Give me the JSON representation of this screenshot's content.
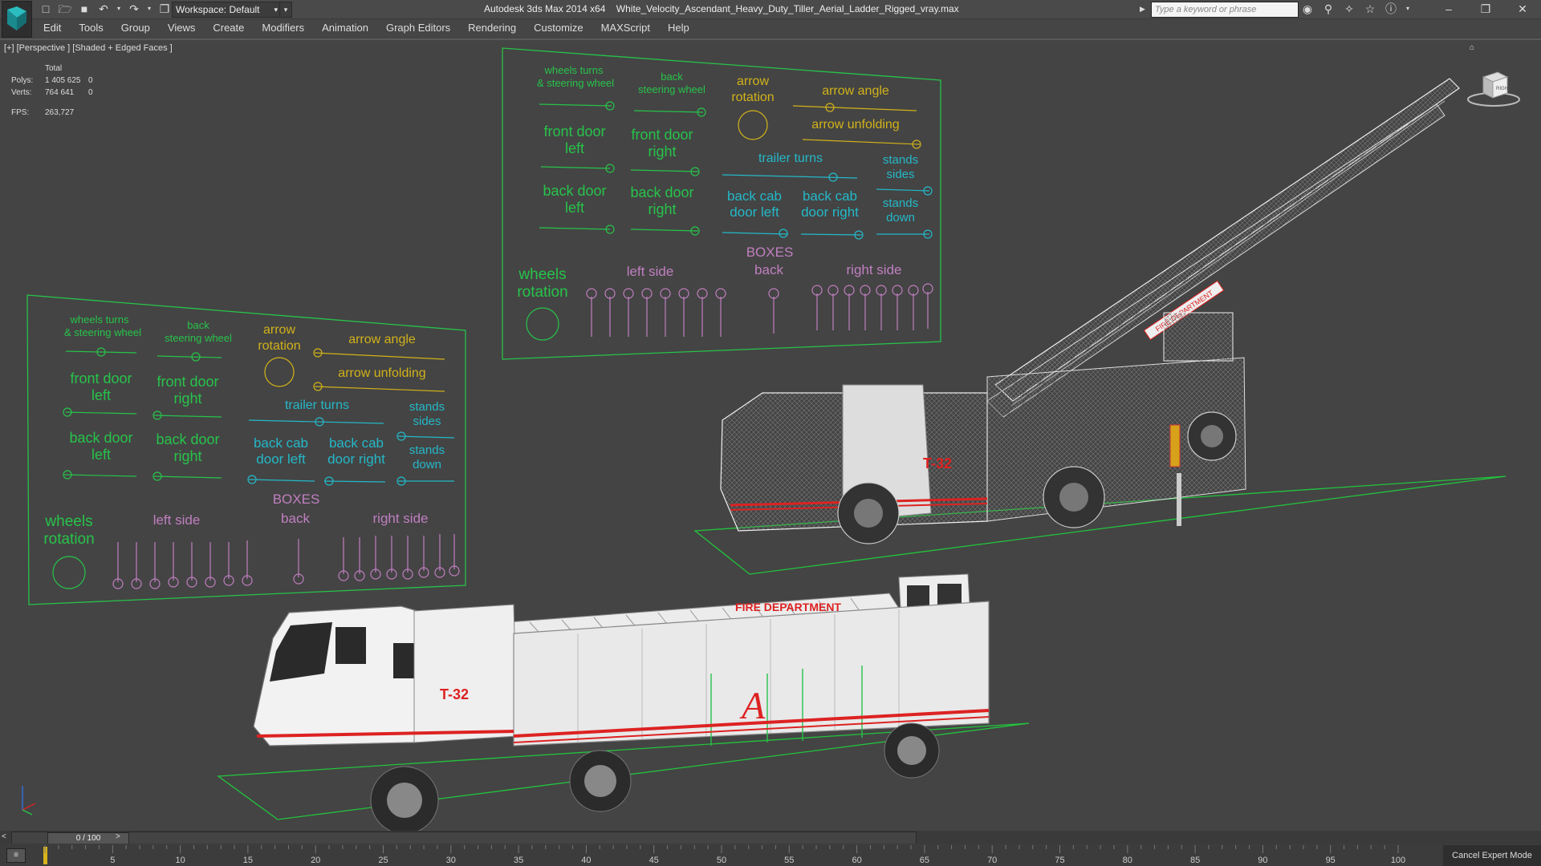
{
  "titlebar": {
    "workspace": "Workspace: Default",
    "app_title": "Autodesk 3ds Max  2014 x64",
    "file_name": "White_Velocity_Ascendant_Heavy_Duty_Tiller_Aerial_Ladder_Rigged_vray.max",
    "search_placeholder": "Type a keyword or phrase",
    "icons": [
      "new-file-icon",
      "open-file-icon",
      "save-icon",
      "undo-icon",
      "redo-icon",
      "project-icon"
    ],
    "right_icons": [
      "binoculars-icon",
      "search-tools-icon",
      "satellite-icon",
      "star-icon",
      "help-icon"
    ],
    "window_controls": [
      "minimize",
      "restore",
      "close"
    ]
  },
  "menu": {
    "items": [
      "Edit",
      "Tools",
      "Group",
      "Views",
      "Create",
      "Modifiers",
      "Animation",
      "Graph Editors",
      "Rendering",
      "Customize",
      "MAXScript",
      "Help"
    ]
  },
  "viewport": {
    "label": "[+] [Perspective ] [Shaded + Edged Faces ]",
    "stats": {
      "header": "Total",
      "polys_label": "Polys:",
      "polys_value": "1 405 625",
      "polys_sel": "0",
      "verts_label": "Verts:",
      "verts_value": "764 641",
      "verts_sel": "0",
      "fps_label": "FPS:",
      "fps_value": "263,727"
    },
    "viewcube_label": "RIGHT",
    "panel": {
      "wheels_turns": "wheels turns",
      "steering_wheel": "& steering wheel",
      "back": "back",
      "steering_wheel_2": "steering wheel",
      "arrow": "arrow",
      "rotation": "rotation",
      "arrow_angle": "arrow angle",
      "arrow_unfolding": "arrow unfolding",
      "front_door": "front door",
      "left": "left",
      "right": "right",
      "trailer_turns": "trailer turns",
      "stands": "stands",
      "sides": "sides",
      "back_door": "back door",
      "back_cab": "back cab",
      "door_left": "door left",
      "door_right": "door right",
      "down": "down",
      "boxes": "BOXES",
      "wheels": "wheels",
      "left_side": "left side",
      "right_side": "right side"
    },
    "truck": {
      "unit_number": "T-32",
      "ladder_text": "FIRE DEPARTMENT"
    }
  },
  "timeline": {
    "frame": "0 / 100",
    "ticks": [
      "5",
      "10",
      "15",
      "20",
      "25",
      "30",
      "35",
      "40",
      "45",
      "50",
      "55",
      "60",
      "65",
      "70",
      "75",
      "80",
      "85",
      "90",
      "95",
      "100"
    ],
    "cancel_mode": "Cancel Expert Mode"
  },
  "colors": {
    "background": "#444444",
    "panel_green": "#27c34a",
    "label_yellow": "#d1b21a",
    "label_cyan": "#24b8c8",
    "label_pink": "#c07fc0"
  }
}
